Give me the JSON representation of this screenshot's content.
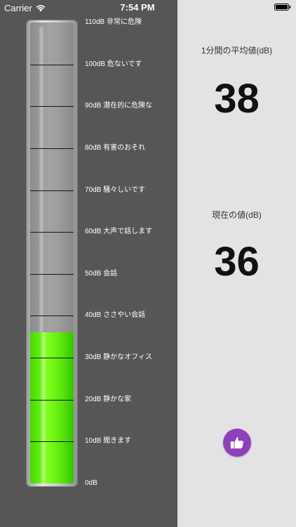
{
  "status_bar": {
    "carrier": "Carrier",
    "time": "7:54 PM",
    "icons": [
      "wifi-icon",
      "battery-icon"
    ]
  },
  "meter": {
    "current_level_db": 36,
    "max_db": 110,
    "fill_color": "#5fe90c",
    "scale": [
      {
        "db": 110,
        "label": "110dB 非常に危険"
      },
      {
        "db": 100,
        "label": "100dB 危ないです"
      },
      {
        "db": 90,
        "label": "90dB 潜在的に危険な"
      },
      {
        "db": 80,
        "label": "80dB 有害のおそれ"
      },
      {
        "db": 70,
        "label": "70dB 騒々しいです"
      },
      {
        "db": 60,
        "label": "60dB 大声で話します"
      },
      {
        "db": 50,
        "label": "50dB 会話"
      },
      {
        "db": 40,
        "label": "40dB ささやい会話"
      },
      {
        "db": 30,
        "label": "30dB 静かなオフィス"
      },
      {
        "db": 20,
        "label": "20dB 静かな家"
      },
      {
        "db": 10,
        "label": "10dB 聞きます"
      },
      {
        "db": 0,
        "label": "0dB"
      }
    ]
  },
  "readouts": {
    "average_label": "1分間の平均値(dB)",
    "average_value": "38",
    "current_label": "現在の値(dB)",
    "current_value": "36"
  },
  "like_button": {
    "icon": "thumbs-up-icon",
    "color": "#8e3fba"
  }
}
